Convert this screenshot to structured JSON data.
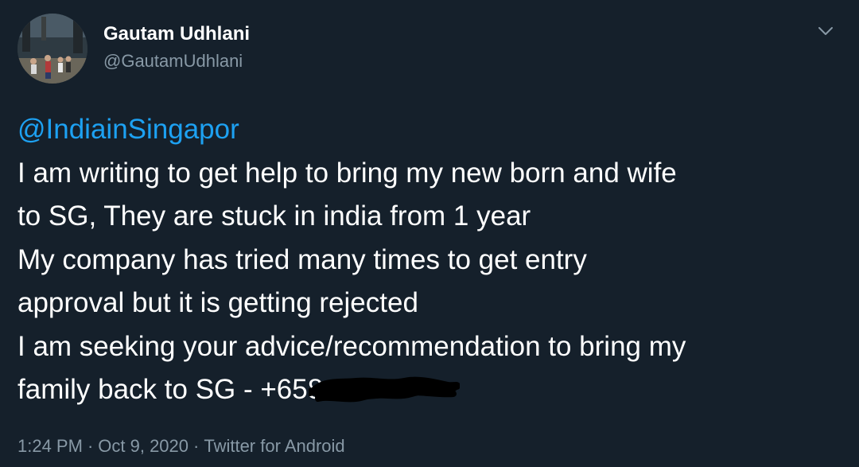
{
  "tweet": {
    "author": {
      "display_name": "Gautam Udhlani",
      "handle": "@GautamUdhlani",
      "avatar_icon": "profile-photo"
    },
    "menu_icon": "chevron-down-icon",
    "mention": "@IndiainSingapor",
    "lines": [
      "I am writing to get help to bring my new born and wife",
      "to SG, They are stuck in india from 1 year",
      "My company has tried many times to get entry",
      "approval but it is getting rejected",
      "I am seeking your advice/recommendation to bring my",
      "family back to SG - +658"
    ],
    "meta": {
      "time": "1:24 PM",
      "separator": "·",
      "date": "Oct 9, 2020",
      "source": "Twitter for Android"
    }
  },
  "colors": {
    "background": "#15202b",
    "text": "#ffffff",
    "secondary_text": "#8899a6",
    "link": "#1da1f2"
  }
}
